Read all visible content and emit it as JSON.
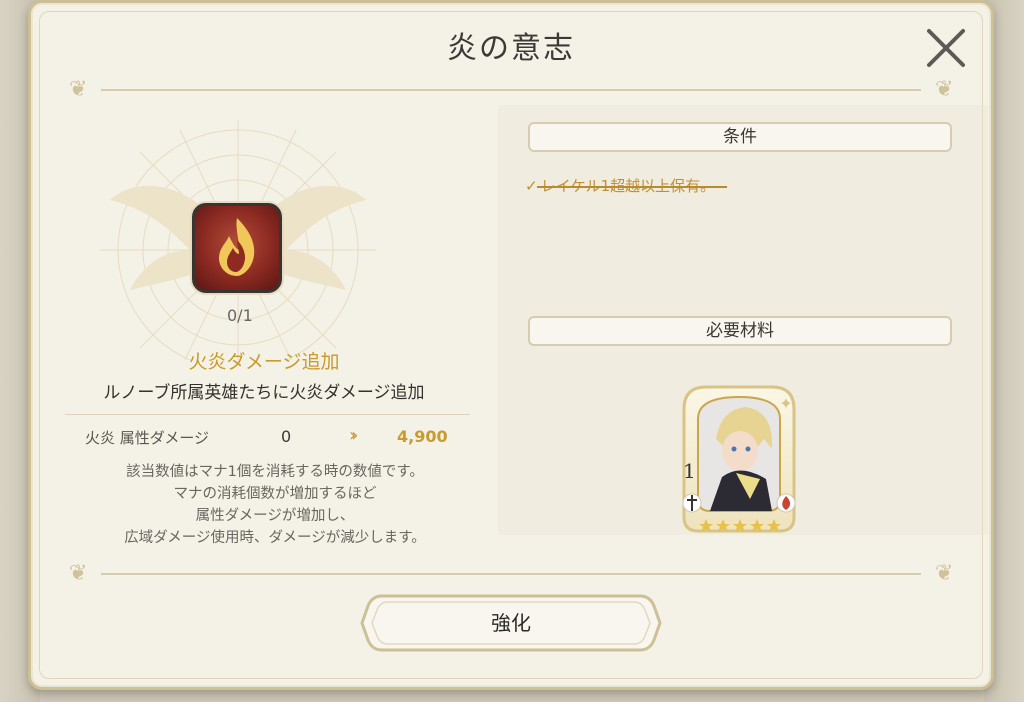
{
  "dialog": {
    "title": "炎の意志"
  },
  "skill": {
    "icon": "fire-flame-icon",
    "count": "0/1",
    "name": "火炎ダメージ追加",
    "description": "ルノーブ所属英雄たちに火炎ダメージ追加",
    "stat_label": "火炎 属性ダメージ",
    "stat_from": "0",
    "stat_to": "4,900",
    "notes": [
      "該当数値はマナ1個を消耗する時の数値です。",
      "マナの消耗個数が増加するほど",
      "属性ダメージが増加し、",
      "広域ダメージ使用時、ダメージが減少します。"
    ]
  },
  "conditions": {
    "header": "条件",
    "items": [
      {
        "text": "レイケル1超越以上保有。",
        "met": true
      }
    ]
  },
  "materials": {
    "header": "必要材料",
    "items": [
      {
        "type": "hero-card",
        "count": "1",
        "stars": 5,
        "element_icon": "fire-element-icon",
        "class_icon": "sword-class-icon"
      }
    ]
  },
  "actions": {
    "enhance_label": "強化"
  },
  "colors": {
    "accent_gold": "#c99a2e",
    "panel_bg": "#f4f1e6",
    "text_dark": "#34322e"
  }
}
